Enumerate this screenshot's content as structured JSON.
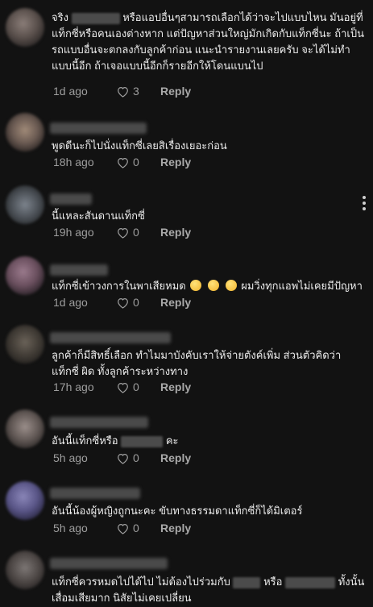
{
  "comments": [
    {
      "text_before": "จริง",
      "text_after": " หรือแอปอื่นๆสามารถเลือกได้ว่าจะไปแบบไหน มันอยู่ที่แท็กซี่หรือคนเองต่างหาก แต่ปัญหาส่วนใหญ่มักเกิดกับแท็กซี่นะ ถ้าเป็นรถแบบอื่นจะตกลงกับลูกค้าก่อน แนะนำรายงานเลยครับ จะได้ไม่ทำแบบนี้อีก ถ้าเจอแบบนี้อีกก็รายอีกให้โดนแบนไป",
      "time": "1d ago",
      "likes": "3",
      "reply": "Reply"
    },
    {
      "text": "พูดดีนะก็ไปนั่งแท็กซี่เลยสิเรื่องเยอะก่อน",
      "time": "18h ago",
      "likes": "0",
      "reply": "Reply"
    },
    {
      "text": "นี้แหละสันดานแท็กซี่",
      "time": "19h ago",
      "likes": "0",
      "reply": "Reply"
    },
    {
      "text_before": "แท็กซี่เข้าวงการในพาเสียหมด",
      "text_after": " ผมวิ่งทุกแอพไม่เคยมีปัญหา",
      "time": "1d ago",
      "likes": "0",
      "reply": "Reply"
    },
    {
      "text": "ลูกค้าก็มีสิทธิ์เลือก ทำไมมาบังคับเราให้จ่ายตังค์เพิ่ม ส่วนตัวคิดว่าแท็กซี่ ผิด ทั้งลูกค้าระหว่างทาง",
      "time": "17h ago",
      "likes": "0",
      "reply": "Reply"
    },
    {
      "text_before": "อันนี้แท็กซี่หรือ",
      "text_after": "คะ",
      "time": "5h ago",
      "likes": "0",
      "reply": "Reply"
    },
    {
      "text": "อันนี้น้องผู้หญิงถูกนะคะ ขับทางธรรมดาแท็กซี่ก็ได้มิเตอร์",
      "time": "5h ago",
      "likes": "0",
      "reply": "Reply"
    },
    {
      "text_before": "แท็กซี่ควรหมดไปได้ไป ไม่ต้องไปร่วมกับ",
      "text_mid": " หรือ",
      "text_after": "ทั้งนั้น เสื่อมเสียมาก นิสัยไม่เคยเปลี่ยน"
    }
  ],
  "icons": {
    "like": "heart-outline-icon",
    "more": "more-vertical-icon",
    "emoji": "face-with-rolling-eyes-icon"
  },
  "colors": {
    "background": "#121212",
    "text": "#ececec",
    "meta": "#9e9e9e"
  }
}
